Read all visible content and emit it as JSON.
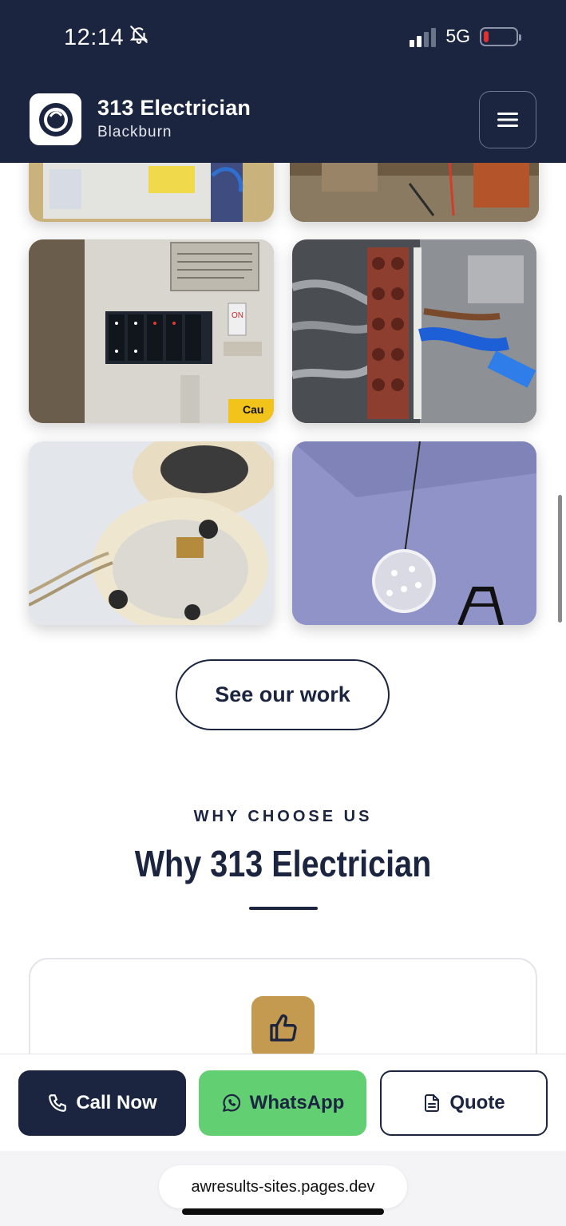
{
  "status": {
    "time": "12:14",
    "network": "5G",
    "battery_level": 0.1
  },
  "header": {
    "title": "313 Electrician",
    "subtitle": "Blackburn"
  },
  "gallery": {
    "images": [
      {
        "subject": "consumer-unit-fusebox"
      },
      {
        "subject": "old-wiring-wall"
      },
      {
        "subject": "fuse-board-switches"
      },
      {
        "subject": "terminal-block-wiring"
      },
      {
        "subject": "ceiling-rose-base"
      },
      {
        "subject": "crystal-pendant-light"
      }
    ],
    "tile_labels": {
      "on_switch": "ON",
      "caution": "Cau"
    }
  },
  "cta": {
    "see_work_label": "See our work"
  },
  "why": {
    "eyebrow": "WHY CHOOSE US",
    "title": "Why 313 Electrician"
  },
  "actions": {
    "call_label": "Call Now",
    "whatsapp_label": "WhatsApp",
    "quote_label": "Quote"
  },
  "browser": {
    "url": "awresults-sites.pages.dev"
  },
  "colors": {
    "navy": "#1b2540",
    "whatsapp_green": "#63cf73",
    "gold": "#c49a50"
  },
  "icons": [
    "bell-off-icon",
    "signal-icon",
    "battery-icon",
    "hamburger-menu-icon",
    "phone-icon",
    "whatsapp-icon",
    "document-icon",
    "thumbs-up-icon"
  ]
}
